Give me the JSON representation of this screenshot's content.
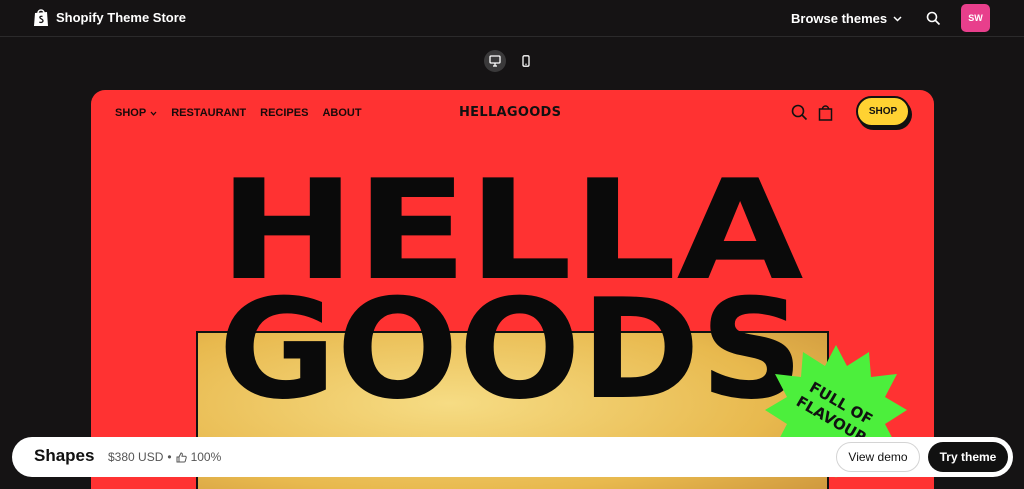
{
  "topbar": {
    "brand": "Shopify Theme Store",
    "browse_label": "Browse themes",
    "avatar_initials": "SW",
    "avatar_color": "#e83f8c"
  },
  "device_toggle": {
    "desktop_icon": "desktop-icon",
    "mobile_icon": "mobile-icon",
    "active": "desktop"
  },
  "preview": {
    "bg_color": "#ff3232",
    "nav": [
      "SHOP",
      "RESTAURANT",
      "RECIPES",
      "ABOUT"
    ],
    "logo": "HELLAGOODS",
    "shop_button": "SHOP",
    "hero_line1": "HELLA",
    "hero_line2": "GOODS",
    "badge_line1": "FULL OF",
    "badge_line2": "FLAVOUR",
    "badge_color": "#4cef3c"
  },
  "bottombar": {
    "theme_name": "Shapes",
    "price": "$380 USD",
    "rating": "100%",
    "view_demo": "View demo",
    "try_theme": "Try theme"
  }
}
